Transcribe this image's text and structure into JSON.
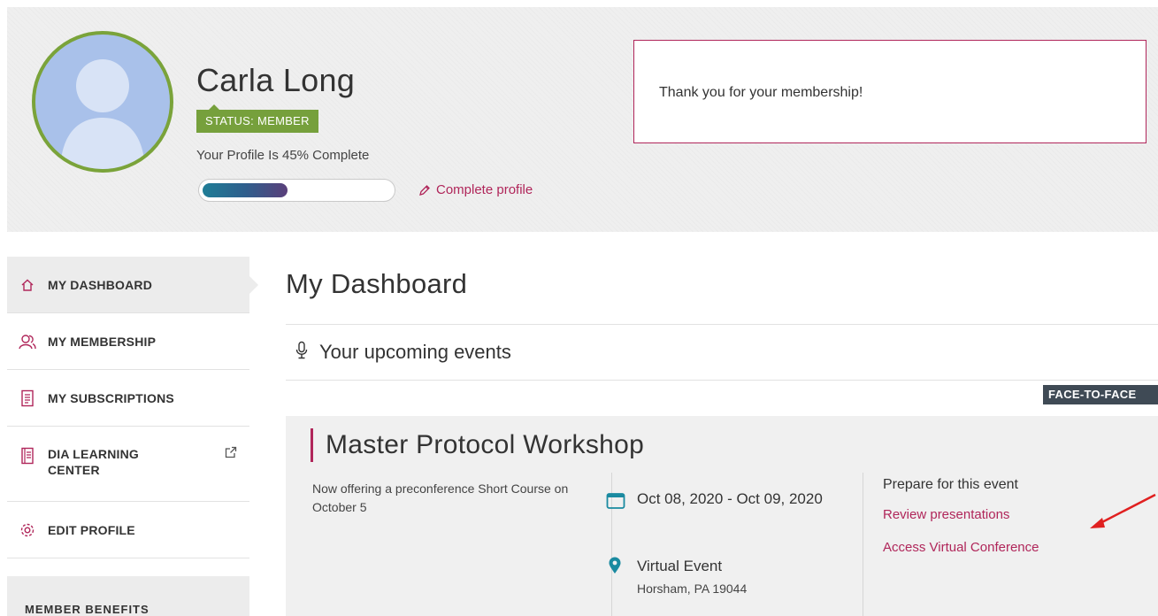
{
  "profile": {
    "name": "Carla Long",
    "status": "STATUS: MEMBER",
    "completion_text": "Your Profile Is 45% Complete",
    "completion_fraction": 0.45,
    "complete_link": "Complete profile"
  },
  "notice": {
    "message": "Thank you for your membership!"
  },
  "sidebar": {
    "items": [
      {
        "label": "MY DASHBOARD",
        "icon": "home-icon"
      },
      {
        "label": "MY MEMBERSHIP",
        "icon": "users-icon"
      },
      {
        "label": "MY SUBSCRIPTIONS",
        "icon": "document-icon"
      },
      {
        "label": "DIA LEARNING CENTER",
        "icon": "book-icon",
        "external": true
      },
      {
        "label": "EDIT PROFILE",
        "icon": "gear-icon"
      }
    ],
    "benefits_label": "MEMBER BENEFITS"
  },
  "main": {
    "title": "My Dashboard",
    "upcoming_title": "Your upcoming events",
    "event_type_badge": "FACE-TO-FACE",
    "event": {
      "title": "Master Protocol Workshop",
      "description": "Now offering a preconference Short Course on October 5",
      "date": "Oct 08, 2020 - Oct 09, 2020",
      "location": "Virtual Event",
      "address": "Horsham, PA 19044",
      "prepare_title": "Prepare for this event",
      "links": [
        "Review presentations",
        "Access Virtual Conference"
      ]
    }
  },
  "colors": {
    "accent": "#b0265a",
    "status_green": "#76a03c",
    "teal": "#1a8aa0",
    "arrow_red": "#e02020"
  }
}
